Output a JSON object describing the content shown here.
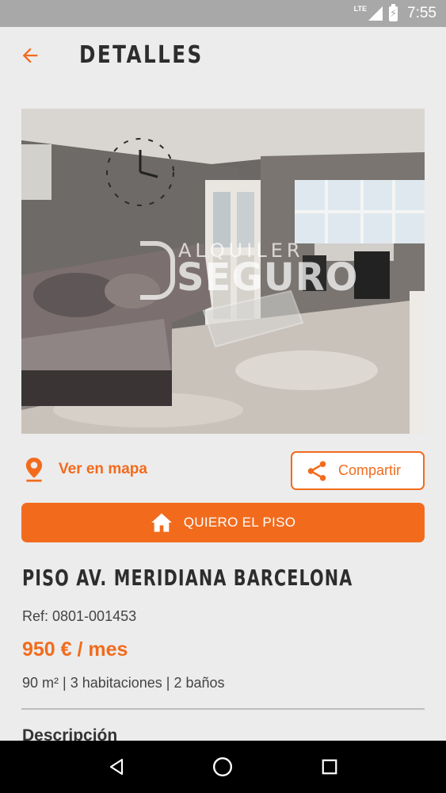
{
  "status_bar": {
    "network": "LTE",
    "time": "7:55",
    "icons": [
      "signal-icon",
      "battery-charging-icon"
    ]
  },
  "header": {
    "title": "DETALLES",
    "back_icon": "arrow-left-icon"
  },
  "photo": {
    "watermark_top": "ALQUILER",
    "watermark_bottom": "SEGURO"
  },
  "actions": {
    "map_label": "Ver en mapa",
    "map_icon": "location-pin-icon",
    "share_label": "Compartir",
    "share_icon": "share-icon",
    "cta_label": "QUIERO EL PISO",
    "cta_icon": "home-icon"
  },
  "listing": {
    "title": "PISO AV. MERIDIANA BARCELONA",
    "ref": "Ref: 0801-001453",
    "price": "950 € / mes",
    "specs": "90  m² | 3 habitaciones | 2 baños",
    "description_heading": "Descripción"
  },
  "nav_bar": {
    "buttons": [
      "back-triangle-icon",
      "home-circle-icon",
      "recents-square-icon"
    ]
  },
  "colors": {
    "accent": "#f26b1d",
    "background": "#ececec",
    "status_bar": "#a8a8a8",
    "nav_bar": "#000000"
  }
}
